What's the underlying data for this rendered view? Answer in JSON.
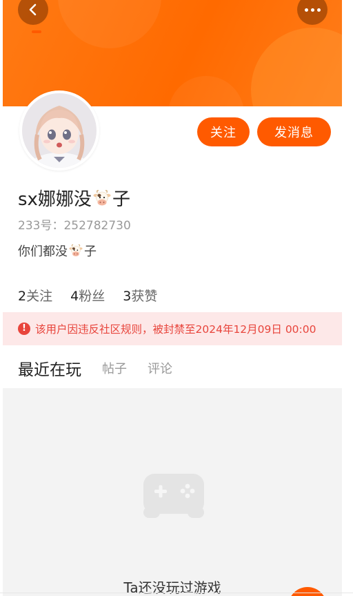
{
  "profile": {
    "follow_label": "关注",
    "message_label": "发消息",
    "name_part1": "sx娜娜没",
    "name_part2": "子",
    "uid_label": "233号：",
    "uid_value": "252782730",
    "bio_part1": "你们都没",
    "bio_part2": "子"
  },
  "stats": {
    "following_count": "2",
    "following_label": "关注",
    "fans_count": "4",
    "fans_label": "粉丝",
    "likes_count": "3",
    "likes_label": "获赞"
  },
  "notice": {
    "icon_text": "!",
    "text": "该用户因违反社区规则，被封禁至2024年12月09日 00:00"
  },
  "tabs": [
    {
      "label": "最近在玩"
    },
    {
      "label": "帖子"
    },
    {
      "label": "评论"
    }
  ],
  "empty_state": {
    "text": "Ta还没玩过游戏"
  },
  "colors": {
    "accent": "#ff5a00",
    "banner": "#ff6a00",
    "notice_bg": "#fde8e8",
    "notice_text": "#e8453c"
  },
  "icons": {
    "back": "chevron-left-icon",
    "more": "more-dots-icon",
    "cow": "cow-emoji-icon",
    "warning": "exclamation-circle-icon",
    "empty": "gamepad-icon"
  }
}
